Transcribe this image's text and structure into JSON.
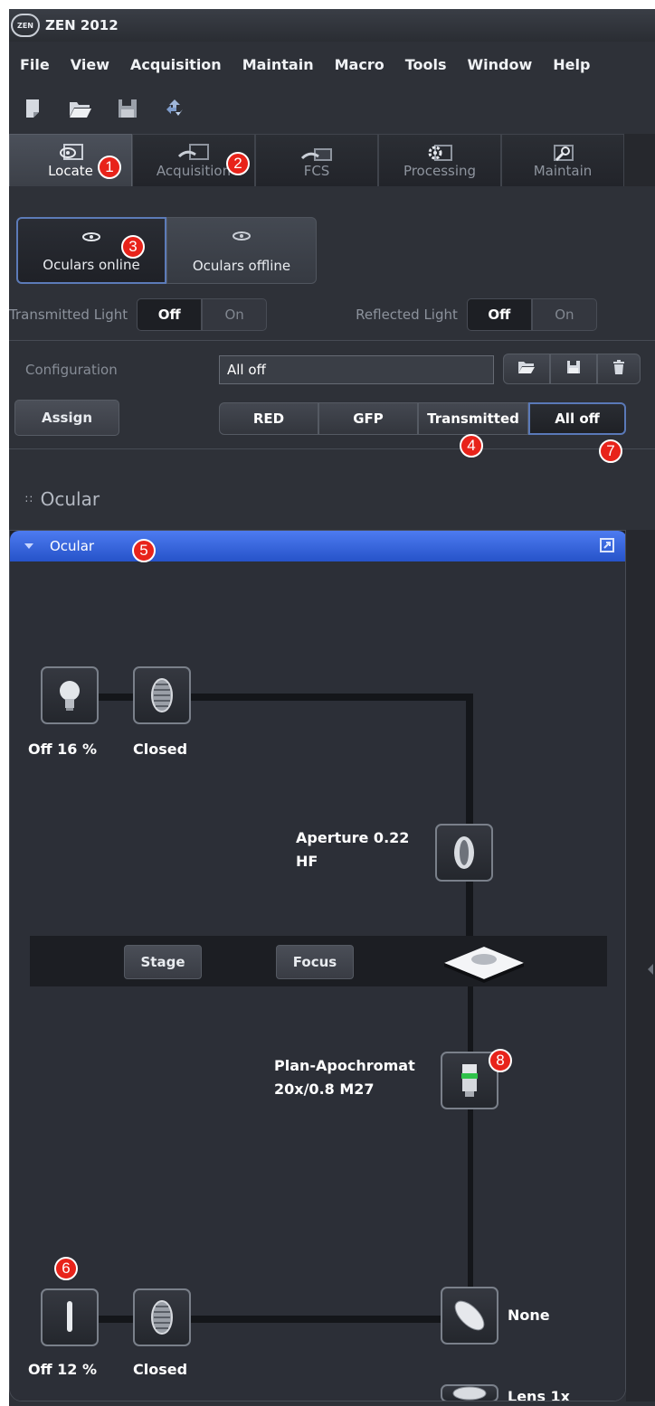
{
  "app": {
    "logo_text": "ZEN",
    "title": "ZEN 2012"
  },
  "menu": [
    "File",
    "View",
    "Acquisition",
    "Maintain",
    "Macro",
    "Tools",
    "Window",
    "Help"
  ],
  "toolbar": [
    "new-document-icon",
    "open-folder-icon",
    "save-icon",
    "reuse-icon"
  ],
  "tabs": [
    {
      "label": "Locate",
      "icon": "eye-icon",
      "active": true
    },
    {
      "label": "Acquisition",
      "icon": "acquisition-icon",
      "active": false
    },
    {
      "label": "FCS",
      "icon": "fcs-icon",
      "active": false
    },
    {
      "label": "Processing",
      "icon": "gear-icon",
      "active": false
    },
    {
      "label": "Maintain",
      "icon": "wrench-icon",
      "active": false
    }
  ],
  "oculars": {
    "online": "Oculars online",
    "offline": "Oculars offline",
    "active": "online"
  },
  "transmitted_light": {
    "label": "Transmitted Light",
    "off": "Off",
    "on": "On",
    "state": "Off"
  },
  "reflected_light": {
    "label": "Reflected Light",
    "off": "Off",
    "on": "On",
    "state": "Off"
  },
  "configuration": {
    "label": "Configuration",
    "value": "All off"
  },
  "assign": {
    "label": "Assign"
  },
  "presets": [
    "RED",
    "GFP",
    "Transmitted",
    "All off"
  ],
  "section": {
    "title": "Ocular"
  },
  "panel": {
    "title": "Ocular",
    "top_lamp_label": "Off  16 %",
    "top_shutter_label": "Closed",
    "aperture_label_1": "Aperture 0.22",
    "aperture_label_2": "HF",
    "stage_label": "Stage",
    "focus_label": "Focus",
    "objective_label_1": "Plan-Apochromat",
    "objective_label_2": "20x/0.8 M27",
    "bottom_lamp_label": "Off  12 %",
    "bottom_shutter_label": "Closed",
    "reflector_label": "None",
    "lens_label": "Lens 1x"
  },
  "callouts": [
    "1",
    "2",
    "3",
    "4",
    "5",
    "6",
    "7",
    "8"
  ],
  "colors": {
    "accent_blue": "#2653c9",
    "callout_red": "#e8231a",
    "background": "#2e3138"
  }
}
